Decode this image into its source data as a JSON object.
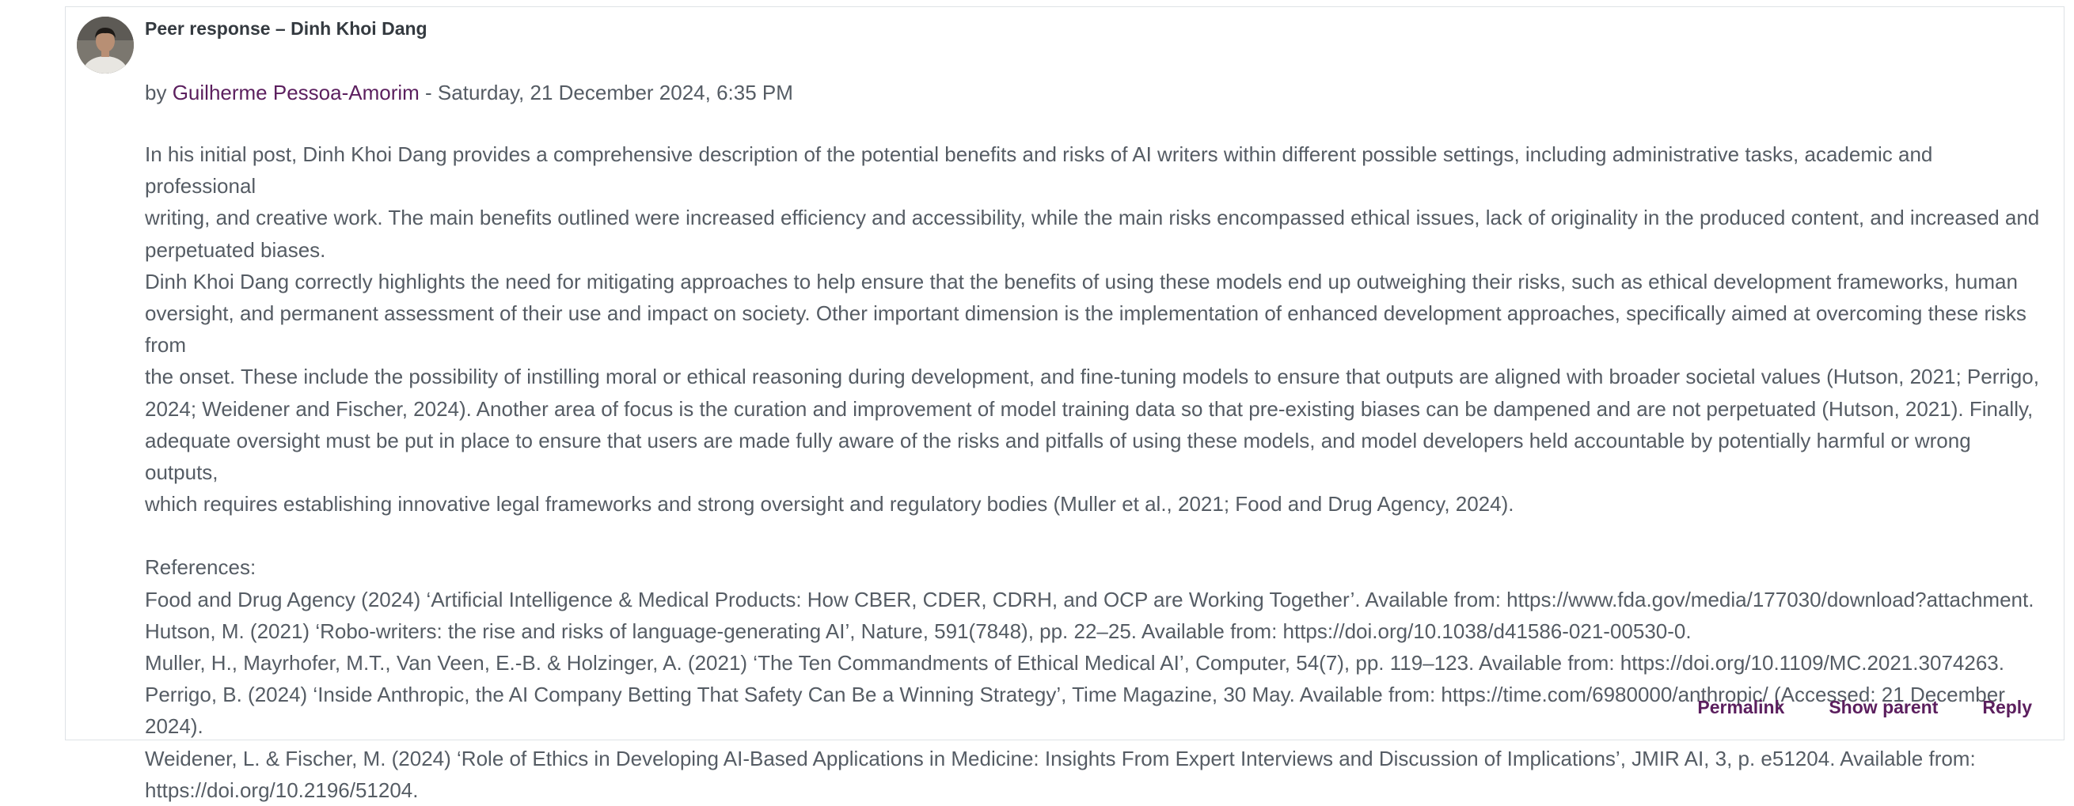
{
  "post": {
    "subject": "Peer response – Dinh Khoi Dang",
    "byline_prefix": "by",
    "author": "Guilherme Pessoa-Amorim",
    "date": "- Saturday, 21 December 2024, 6:35 PM",
    "paragraphs": [
      "In his initial post, Dinh Khoi Dang provides a comprehensive description of the potential benefits and risks of AI writers within different possible settings, including administrative tasks, academic and professional\nwriting, and creative work. The main benefits outlined were increased efficiency and accessibility, while the main risks encompassed ethical issues, lack of originality in the produced content, and increased and\nperpetuated biases.",
      "Dinh Khoi Dang correctly highlights the need for mitigating approaches to help ensure that the benefits of using these models end up outweighing their risks, such as ethical development frameworks, human\noversight, and permanent assessment of their use and impact on society. Other important dimension is the implementation of enhanced development approaches, specifically aimed at overcoming these risks from\nthe onset. These include the possibility of instilling moral or ethical reasoning during development, and fine-tuning models to ensure that outputs are aligned with broader societal values (Hutson, 2021; Perrigo,\n2024; Weidener and Fischer, 2024). Another area of focus is the curation and improvement of model training data so that pre-existing biases can be dampened and are not perpetuated (Hutson, 2021). Finally,\nadequate oversight must be put in place to ensure that users are made fully aware of the risks and pitfalls of using these models, and model developers held accountable by potentially harmful or wrong outputs,\nwhich requires establishing innovative legal frameworks and strong oversight and regulatory bodies (Muller et al., 2021; Food and Drug Agency, 2024)."
    ],
    "references_heading": "References:",
    "references": [
      "Food and Drug Agency (2024) ‘Artificial Intelligence & Medical Products: How CBER, CDER, CDRH, and OCP are Working Together’. Available from: https://www.fda.gov/media/177030/download?attachment.",
      "Hutson, M. (2021) ‘Robo-writers: the rise and risks of language-generating AI’, Nature, 591(7848), pp. 22–25. Available from: https://doi.org/10.1038/d41586-021-00530-0.",
      "Muller, H., Mayrhofer, M.T., Van Veen, E.-B. & Holzinger, A. (2021) ‘The Ten Commandments of Ethical Medical AI’, Computer, 54(7), pp. 119–123. Available from: https://doi.org/10.1109/MC.2021.3074263.",
      "Perrigo, B. (2024) ‘Inside Anthropic, the AI Company Betting That Safety Can Be a Winning Strategy’, Time Magazine, 30 May. Available from: https://time.com/6980000/anthropic/ (Accessed: 21 December 2024).",
      "Weidener, L. & Fischer, M. (2024) ‘Role of Ethics in Developing AI-Based Applications in Medicine: Insights From Expert Interviews and Discussion of Implications’, JMIR AI, 3, p. e51204. Available from:\nhttps://doi.org/10.2196/51204."
    ]
  },
  "commands": {
    "permalink": "Permalink",
    "show_parent": "Show parent",
    "reply": "Reply"
  },
  "colors": {
    "link": "#5b1f5e",
    "text": "#555c64",
    "heading": "#343a40",
    "border": "#dee2e6"
  }
}
